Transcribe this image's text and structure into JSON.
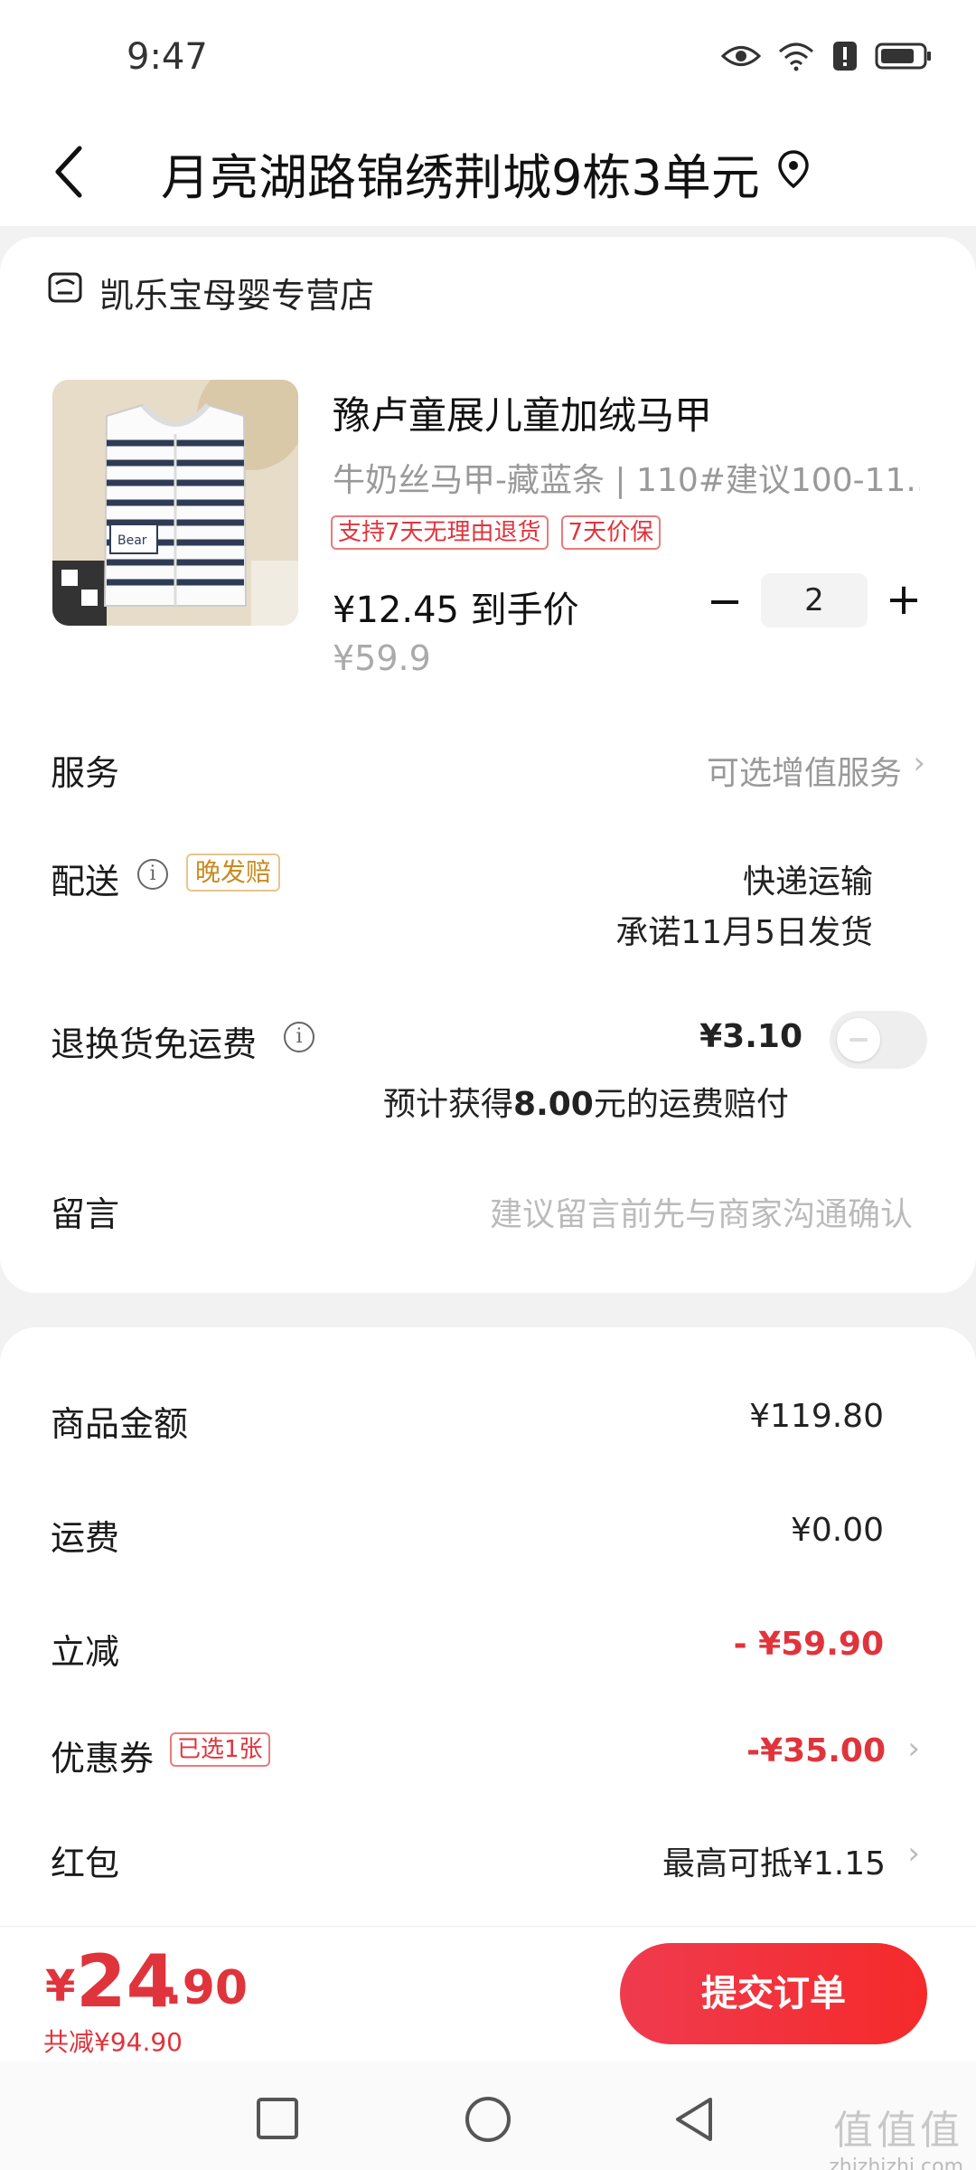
{
  "status_bar": {
    "time": "9:47"
  },
  "header": {
    "address": "月亮湖路锦绣荆城9栋3单元"
  },
  "store": {
    "name": "凯乐宝母婴专营店"
  },
  "product": {
    "title": "豫卢童展儿童加绒马甲",
    "spec": "牛奶丝马甲-藏蓝条 | 110#建议100-11...",
    "tags": [
      "支持7天无理由退货",
      "7天价保"
    ],
    "final_price": "¥12.45 到手价",
    "original_price": "¥59.9",
    "quantity": "2",
    "image_label": "Bear"
  },
  "rows": {
    "service_label": "服务",
    "service_value": "可选增值服务",
    "delivery_label": "配送",
    "delivery_tag": "晚发赔",
    "delivery_method": "快递运输",
    "delivery_promise": "承诺11月5日发货",
    "return_label": "退换货免运费",
    "return_price": "¥3.10",
    "return_note_prefix": "预计获得",
    "return_note_amount": "8.00",
    "return_note_suffix": "元的运费赔付",
    "return_toggle_on": false,
    "message_label": "留言",
    "message_placeholder": "建议留言前先与商家沟通确认"
  },
  "summary": {
    "goods_label": "商品金额",
    "goods_value": "¥119.80",
    "shipping_label": "运费",
    "shipping_value": "¥0.00",
    "discount_label": "立减",
    "discount_value": "- ¥59.90",
    "coupon_label": "优惠券",
    "coupon_tag": "已选1张",
    "coupon_value": "-¥35.00",
    "redpacket_label": "红包",
    "redpacket_value": "最高可抵¥1.15"
  },
  "bottom": {
    "currency": "¥",
    "total_int": "24",
    "total_dec": ".90",
    "saved": "共减¥94.90",
    "submit": "提交订单"
  },
  "watermark": {
    "text": "值值值",
    "url": "zhizhizhi.com"
  },
  "colors": {
    "accent": "#e0343c",
    "button": "#f52a2a"
  }
}
